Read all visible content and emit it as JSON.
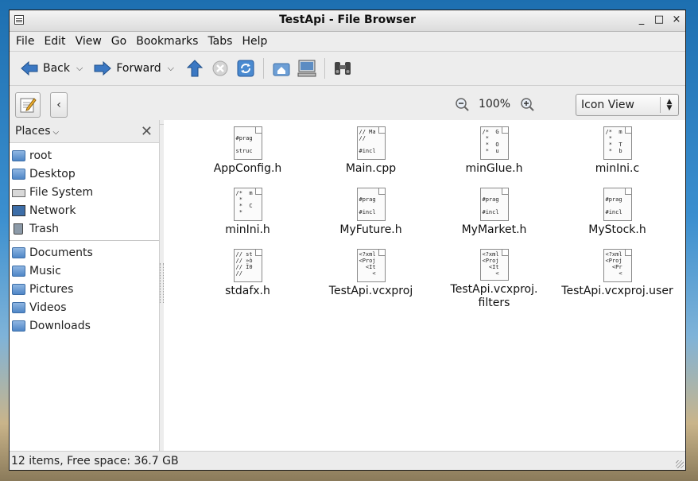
{
  "window": {
    "title": "TestApi - File Browser",
    "controls": [
      "_",
      "□",
      "×"
    ]
  },
  "menu": [
    "File",
    "Edit",
    "View",
    "Go",
    "Bookmarks",
    "Tabs",
    "Help"
  ],
  "toolbar": {
    "back_label": "Back",
    "forward_label": "Forward"
  },
  "location": {
    "zoom_level": "100%",
    "view_mode": "Icon View"
  },
  "places": {
    "title": "Places",
    "items": [
      {
        "label": "root",
        "icon": "home-folder-icon"
      },
      {
        "label": "Desktop",
        "icon": "desktop-folder-icon"
      },
      {
        "label": "File System",
        "icon": "drive-icon"
      },
      {
        "label": "Network",
        "icon": "network-icon"
      },
      {
        "label": "Trash",
        "icon": "trash-icon"
      }
    ],
    "bookmarks": [
      {
        "label": "Documents",
        "icon": "folder-icon"
      },
      {
        "label": "Music",
        "icon": "folder-icon"
      },
      {
        "label": "Pictures",
        "icon": "folder-icon"
      },
      {
        "label": "Videos",
        "icon": "folder-icon"
      },
      {
        "label": "Downloads",
        "icon": "folder-icon"
      }
    ]
  },
  "files": [
    {
      "name": "AppConfig.h",
      "preview": "\n#prag\n\nstruc"
    },
    {
      "name": "Main.cpp",
      "preview": "// Ma\n//\n\n#incl"
    },
    {
      "name": "minGlue.h",
      "preview": "/*  G\n *\n *  O\n *  u"
    },
    {
      "name": "minIni.c",
      "preview": "/*  m\n *\n *  T\n *  b"
    },
    {
      "name": "minIni.h",
      "preview": "/*  m\n *\n *  C\n *"
    },
    {
      "name": "MyFuture.h",
      "preview": "\n#prag\n\n#incl"
    },
    {
      "name": "MyMarket.h",
      "preview": "\n#prag\n\n#incl"
    },
    {
      "name": "MyStock.h",
      "preview": "\n#prag\n\n#incl"
    },
    {
      "name": "stdafx.h",
      "preview": "// st\n// »ò\n// Ï0\n//"
    },
    {
      "name": "TestApi.vcxproj",
      "preview": "<?xml\n<Proj\n  <It\n    <"
    },
    {
      "name": "TestApi.vcxproj.\nfilters",
      "preview": "<?xml\n<Proj\n  <It\n    <"
    },
    {
      "name": "TestApi.vcxproj.user",
      "preview": "<?xml\n<Proj\n  <Pr\n    <"
    }
  ],
  "status": {
    "text": "12 items, Free space: 36.7 GB"
  }
}
